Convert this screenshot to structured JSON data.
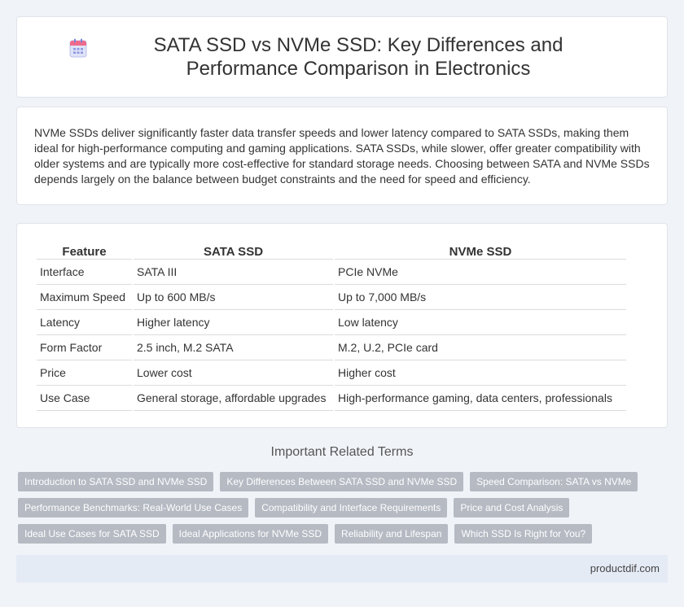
{
  "header": {
    "title": "SATA SSD vs NVMe SSD: Key Differences and Performance Comparison in Electronics",
    "icon": "calendar-icon"
  },
  "intro": {
    "text": "NVMe SSDs deliver significantly faster data transfer speeds and lower latency compared to SATA SSDs, making them ideal for high-performance computing and gaming applications. SATA SSDs, while slower, offer greater compatibility with older systems and are typically more cost-effective for standard storage needs. Choosing between SATA and NVMe SSDs depends largely on the balance between budget constraints and the need for speed and efficiency."
  },
  "table": {
    "headers": [
      "Feature",
      "SATA SSD",
      "NVMe SSD"
    ],
    "rows": [
      [
        "Interface",
        "SATA III",
        "PCIe NVMe"
      ],
      [
        "Maximum Speed",
        "Up to 600 MB/s",
        "Up to 7,000 MB/s"
      ],
      [
        "Latency",
        "Higher latency",
        "Low latency"
      ],
      [
        "Form Factor",
        "2.5 inch, M.2 SATA",
        "M.2, U.2, PCIe card"
      ],
      [
        "Price",
        "Lower cost",
        "Higher cost"
      ],
      [
        "Use Case",
        "General storage, affordable upgrades",
        "High-performance gaming, data centers, professionals"
      ]
    ]
  },
  "related": {
    "title": "Important Related Terms",
    "rows": [
      [
        "Introduction to SATA SSD and NVMe SSD",
        "Key Differences Between SATA SSD and NVMe SSD",
        "Speed Comparison: SATA vs NVMe"
      ],
      [
        "Performance Benchmarks: Real-World Use Cases",
        "Compatibility and Interface Requirements",
        "Price and Cost Analysis"
      ],
      [
        "Ideal Use Cases for SATA SSD",
        "Ideal Applications for NVMe SSD",
        "Reliability and Lifespan",
        "Which SSD Is Right for You?"
      ]
    ]
  },
  "footer": {
    "site": "productdif.com"
  },
  "colors": {
    "background": "#f0f3f8",
    "tag": "#b5bac3",
    "footer": "#e5ebf5"
  }
}
